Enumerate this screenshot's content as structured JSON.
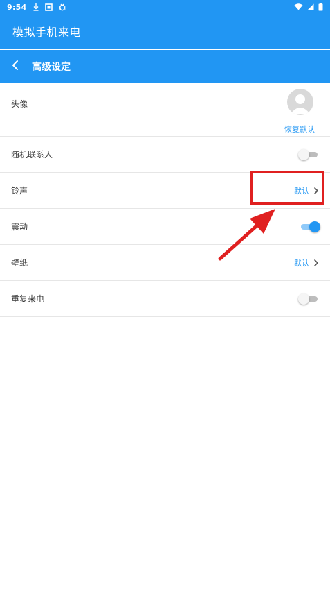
{
  "status_bar": {
    "time": "9:54",
    "icons_left": [
      "download-icon",
      "notification-square-icon",
      "bug-icon"
    ],
    "icons_right": [
      "wifi-icon",
      "cellular-signal-icon",
      "battery-icon"
    ]
  },
  "app_bar": {
    "title": "模拟手机来电"
  },
  "sub_header": {
    "title": "高级设定",
    "back_icon": "chevron-left-icon"
  },
  "settings": {
    "avatar": {
      "label": "头像",
      "restore_label": "恢复默认"
    },
    "random_contact": {
      "label": "随机联系人",
      "enabled": false
    },
    "ringtone": {
      "label": "铃声",
      "value": "默认"
    },
    "vibration": {
      "label": "震动",
      "enabled": true
    },
    "wallpaper": {
      "label": "壁纸",
      "value": "默认"
    },
    "repeat_call": {
      "label": "重复来电",
      "enabled": false
    }
  },
  "annotation": {
    "box_color": "#e02020",
    "arrow_color": "#e02020",
    "target": "ringtone"
  },
  "colors": {
    "primary": "#2196f3",
    "divider": "#e6e6e6",
    "text": "#333333"
  }
}
